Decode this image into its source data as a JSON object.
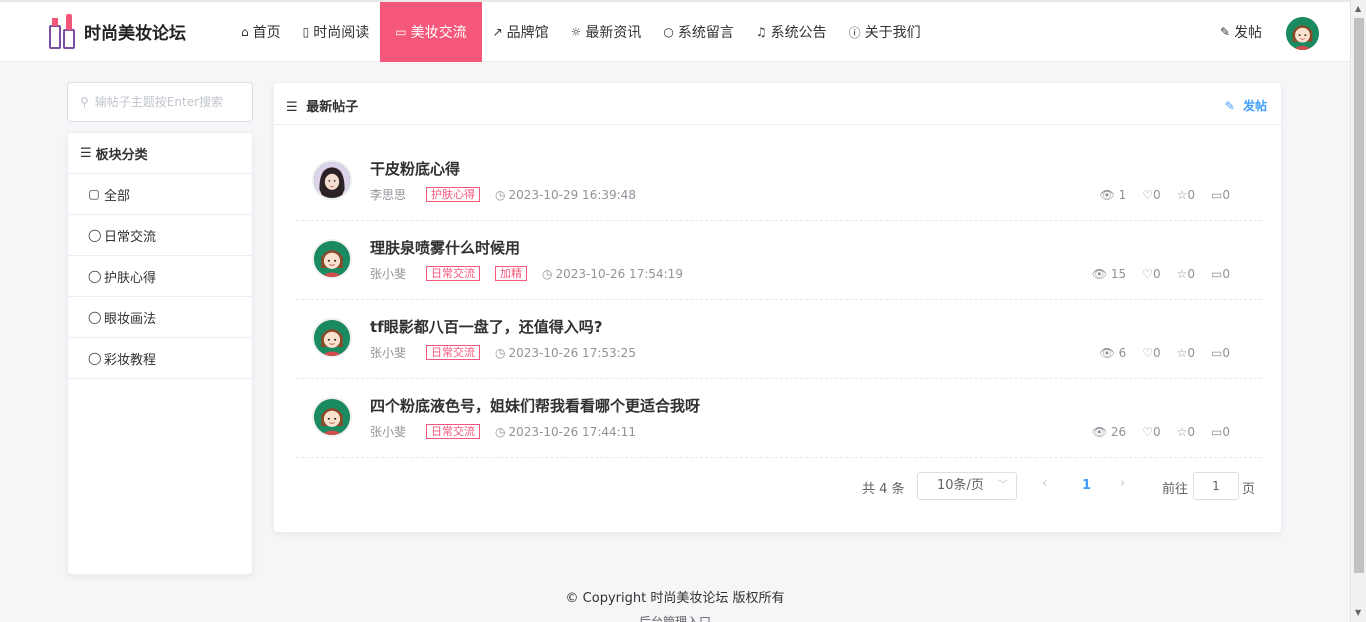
{
  "header": {
    "logo_text": "时尚美妆论坛",
    "nav": [
      {
        "icon": "⌂",
        "label": "首页"
      },
      {
        "icon": "▯",
        "label": "时尚阅读"
      },
      {
        "icon": "▭",
        "label": "美妆交流"
      },
      {
        "icon": "↗",
        "label": "品牌馆"
      },
      {
        "icon": "☼",
        "label": "最新资讯"
      },
      {
        "icon": "○",
        "label": "系统留言"
      },
      {
        "icon": "♫",
        "label": "系统公告"
      },
      {
        "icon": "ⓘ",
        "label": "关于我们"
      }
    ],
    "active_index": 2,
    "post_label": "发帖",
    "post_icon": "✎"
  },
  "sidebar": {
    "search_placeholder": "输帖子主题按Enter搜索",
    "title": "板块分类",
    "items": [
      {
        "icon": "▢",
        "label": "全部"
      },
      {
        "icon": "◯",
        "label": "日常交流"
      },
      {
        "icon": "◯",
        "label": "护肤心得"
      },
      {
        "icon": "◯",
        "label": "眼妆画法"
      },
      {
        "icon": "◯",
        "label": "彩妆教程"
      }
    ]
  },
  "main": {
    "title": "最新帖子",
    "post_label": "发帖",
    "posts": [
      {
        "title": "干皮粉底心得",
        "author": "李思思",
        "tags": [
          "护肤心得"
        ],
        "time": "2023-10-29 16:39:48",
        "views": "1",
        "likes": "0",
        "stars": "0",
        "comments": "0",
        "avatar": "photo"
      },
      {
        "title": "理肤泉喷雾什么时候用",
        "author": "张小斐",
        "tags": [
          "日常交流",
          "加精"
        ],
        "time": "2023-10-26 17:54:19",
        "views": "15",
        "likes": "0",
        "stars": "0",
        "comments": "0",
        "avatar": "cartoon"
      },
      {
        "title": "tf眼影都八百一盘了，还值得入吗?",
        "author": "张小斐",
        "tags": [
          "日常交流"
        ],
        "time": "2023-10-26 17:53:25",
        "views": "6",
        "likes": "0",
        "stars": "0",
        "comments": "0",
        "avatar": "cartoon"
      },
      {
        "title": "四个粉底液色号，姐妹们帮我看看哪个更适合我呀",
        "author": "张小斐",
        "tags": [
          "日常交流"
        ],
        "time": "2023-10-26 17:44:11",
        "views": "26",
        "likes": "0",
        "stars": "0",
        "comments": "0",
        "avatar": "cartoon"
      }
    ]
  },
  "pagination": {
    "total": "共 4 条",
    "page_size": "10条/页",
    "current": "1",
    "goto_label": "前往",
    "goto_value": "1",
    "page_label": "页"
  },
  "footer": {
    "copyright": "© Copyright 时尚美妆论坛 版权所有",
    "admin_link": "后台管理入口"
  },
  "colors": {
    "accent": "#f5577a",
    "link": "#409eff"
  },
  "icons": {
    "view": "eye-icon",
    "like": "heart-icon",
    "star": "star-icon",
    "comment": "comment-icon"
  }
}
